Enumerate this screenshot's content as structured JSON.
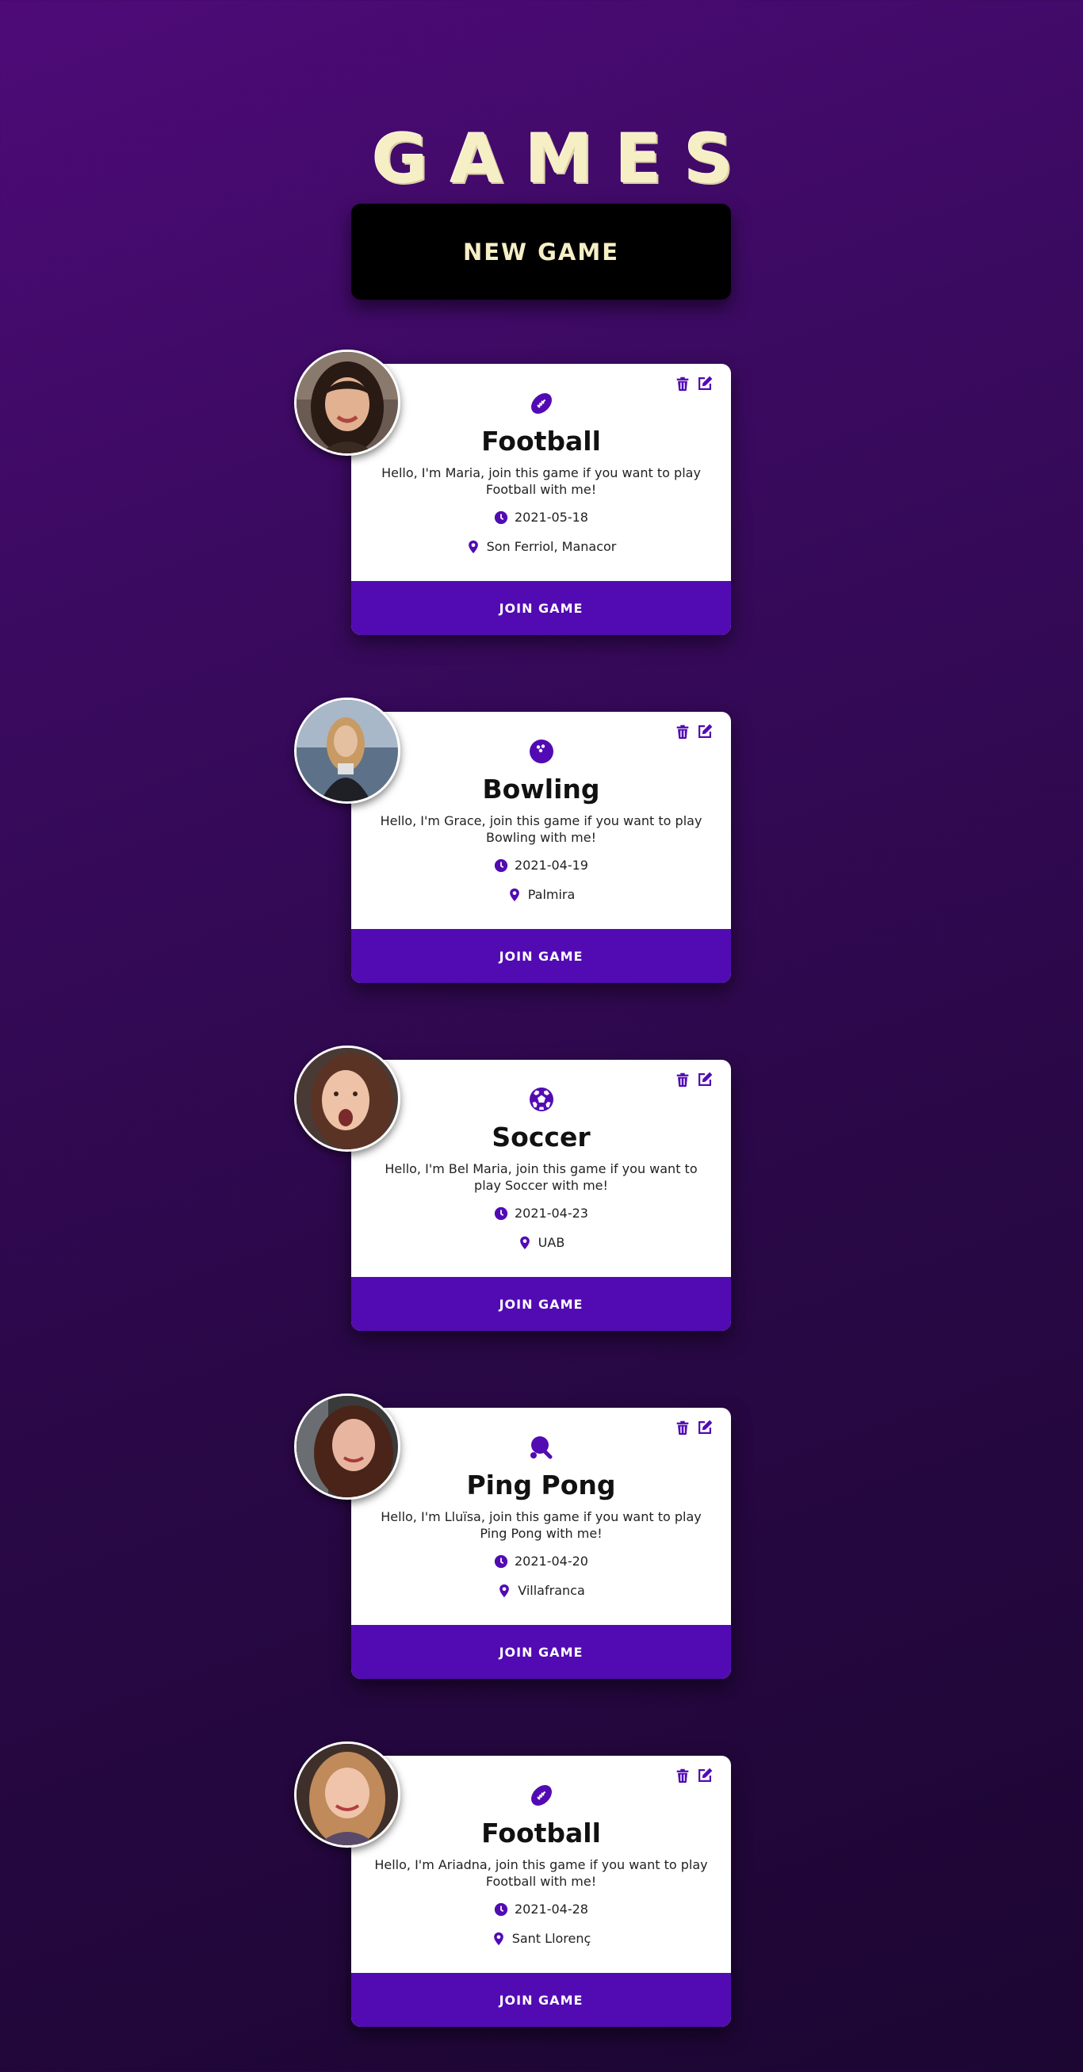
{
  "page": {
    "title": "GAMES",
    "new_game_label": "NEW GAME"
  },
  "colors": {
    "accent": "#520bb3",
    "title": "#f6efc6",
    "background_top": "#4e0b78",
    "background_bottom": "#1c0632"
  },
  "games": [
    {
      "sport": "Football",
      "sport_icon": "football-icon",
      "description": "Hello, I'm Maria, join this game if you want to play Football with me!",
      "date": "2021-05-18",
      "location": "Son Ferriol, Manacor",
      "join_label": "JOIN GAME"
    },
    {
      "sport": "Bowling",
      "sport_icon": "bowling-ball-icon",
      "description": "Hello, I'm Grace, join this game if you want to play Bowling with me!",
      "date": "2021-04-19",
      "location": "Palmira",
      "join_label": "JOIN GAME"
    },
    {
      "sport": "Soccer",
      "sport_icon": "soccer-ball-icon",
      "description": "Hello, I'm Bel Maria, join this game if you want to play Soccer with me!",
      "date": "2021-04-23",
      "location": "UAB",
      "join_label": "JOIN GAME"
    },
    {
      "sport": "Ping Pong",
      "sport_icon": "ping-pong-icon",
      "description": "Hello, I'm Lluïsa, join this game if you want to play Ping Pong with me!",
      "date": "2021-04-20",
      "location": "Villafranca",
      "join_label": "JOIN GAME"
    },
    {
      "sport": "Football",
      "sport_icon": "football-icon",
      "description": "Hello, I'm Ariadna, join this game if you want to play Football with me!",
      "date": "2021-04-28",
      "location": "Sant Llorenç",
      "join_label": "JOIN GAME"
    }
  ]
}
